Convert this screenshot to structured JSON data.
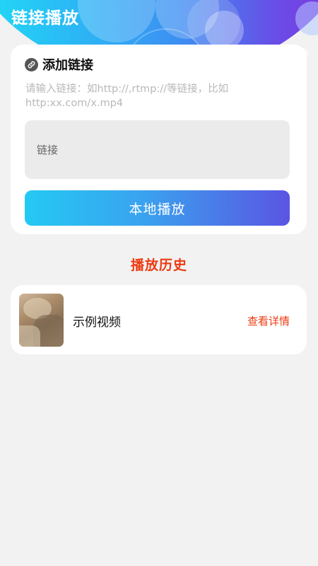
{
  "header": {
    "title": "链接播放"
  },
  "link_card": {
    "title": "添加链接",
    "icon": "link-icon",
    "hint": "请输入链接：如http://,rtmp://等链接，比如http:xx.com/x.mp4",
    "input_placeholder": "链接",
    "input_value": "",
    "button_label": "本地播放"
  },
  "history": {
    "title": "播放历史",
    "items": [
      {
        "name": "示例视频",
        "action_label": "查看详情"
      }
    ]
  },
  "colors": {
    "accent": "#ee3a12",
    "gradient_start": "#24c9f3",
    "gradient_end": "#5a55e3",
    "background": "#f2f2f2"
  }
}
